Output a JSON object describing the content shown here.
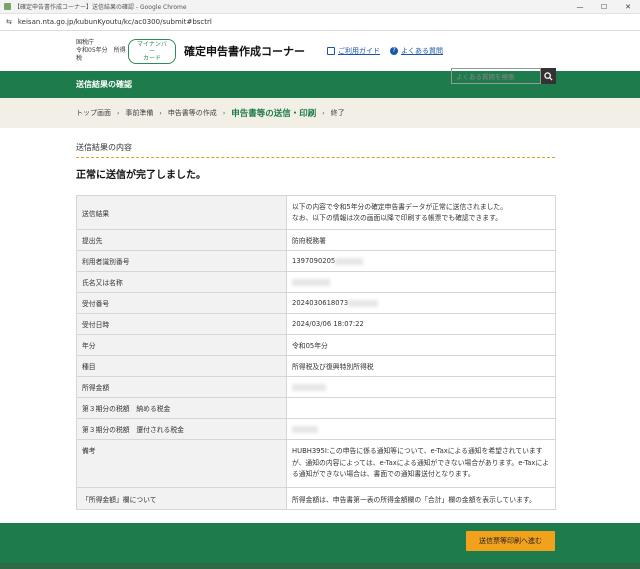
{
  "window": {
    "title": "【確定申告書作成コーナー】送信結果の確認 - Google Chrome",
    "minimize_glyph": "—",
    "maximize_glyph": "☐",
    "close_glyph": "✕"
  },
  "browser": {
    "url": "keisan.nta.go.jp/kubunKyoutu/kc/ac0300/submit#bsctrl",
    "site_settings_glyph": "⇆"
  },
  "header": {
    "org_line1": "国税庁",
    "org_line2": "令和05年分　所得税",
    "mynumber_badge": "マイナンバー\nカード",
    "site_title": "確定申告書作成コーナー",
    "guide_link": "ご利用ガイド",
    "faq_link": "よくある質問",
    "search_placeholder": "よくある質問を検索",
    "faq_glyph": "?"
  },
  "page_band": {
    "title": "送信結果の確認"
  },
  "breadcrumb": {
    "items": [
      "トップ画面",
      "事前準備",
      "申告書等の作成",
      "申告書等の送信・印刷",
      "終了"
    ],
    "separator": "›"
  },
  "main": {
    "section_label": "送信結果の内容",
    "completion_message": "正常に送信が完了しました。",
    "rows": [
      {
        "label": "送信結果",
        "value": "以下の内容で令和5年分の確定申告書データが正常に送信されました。\nなお、以下の情報は次の画面以降で印刷する帳票でも確認できます。"
      },
      {
        "label": "提出先",
        "value": "防府税務署"
      },
      {
        "label": "利用者識別番号",
        "value": "1397090205"
      },
      {
        "label": "氏名又は名称",
        "value": ""
      },
      {
        "label": "受付番号",
        "value": "2024030618073"
      },
      {
        "label": "受付日時",
        "value": "2024/03/06 18:07:22"
      },
      {
        "label": "年分",
        "value": "令和05年分"
      },
      {
        "label": "種目",
        "value": "所得税及び復興特別所得税"
      },
      {
        "label": "所得金額",
        "value": ""
      },
      {
        "label": "第３期分の税額　納める税金",
        "value": ""
      },
      {
        "label": "第３期分の税額　還付される税金",
        "value": ""
      },
      {
        "label": "備考",
        "value": "HUBH395I:この申告に係る通知等について、e-Taxによる通知を希望されていますが、通知の内容によっては、e-Taxによる通知ができない場合があります。e-Taxによる通知ができない場合は、書面での通知書送付となります。"
      },
      {
        "label": "「所得金額」欄について",
        "value": "所得金額は、申告書第一表の所得金額欄の「合計」欄の金額を表示しています。"
      }
    ]
  },
  "footer": {
    "print_button": "送信票等印刷へ進む"
  }
}
